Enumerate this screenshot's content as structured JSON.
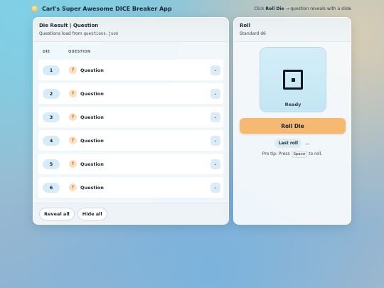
{
  "app": {
    "title": "Carl's Super Awesome DICE Breaker App",
    "hint_prefix": "Click",
    "hint_strong": "Roll Die",
    "hint_suffix": "→ question reveals with a slide"
  },
  "left_card": {
    "title": "Die Result | Question",
    "subtitle_prefix": "Questions load from",
    "subtitle_file": "questions.json",
    "columns": {
      "die": "DIE",
      "question": "QUESTION"
    },
    "rows": [
      {
        "die": "1",
        "badge": "?",
        "question": "Question",
        "toggle": "⌄"
      },
      {
        "die": "2",
        "badge": "?",
        "question": "Question",
        "toggle": "⌄"
      },
      {
        "die": "3",
        "badge": "?",
        "question": "Question",
        "toggle": "⌄"
      },
      {
        "die": "4",
        "badge": "?",
        "question": "Question",
        "toggle": "⌄"
      },
      {
        "die": "5",
        "badge": "?",
        "question": "Question",
        "toggle": "⌄"
      },
      {
        "die": "6",
        "badge": "?",
        "question": "Question",
        "toggle": "⌄"
      }
    ],
    "buttons": {
      "reveal_all": "Reveal all",
      "hide_all": "Hide all"
    }
  },
  "right_card": {
    "title": "Roll",
    "subtitle": "Standard d6",
    "die_face_value": 1,
    "die_status": "Ready",
    "roll_button": "Roll Die",
    "last_roll_label": "Last roll",
    "last_roll_value": "—",
    "protip_prefix": "Pro tip: Press",
    "protip_key": "Space",
    "protip_suffix": "to roll."
  },
  "colors": {
    "roll_button": "#f5b971",
    "die_pill": "#d6ecf9",
    "question_badge": "#fbe0c2"
  }
}
